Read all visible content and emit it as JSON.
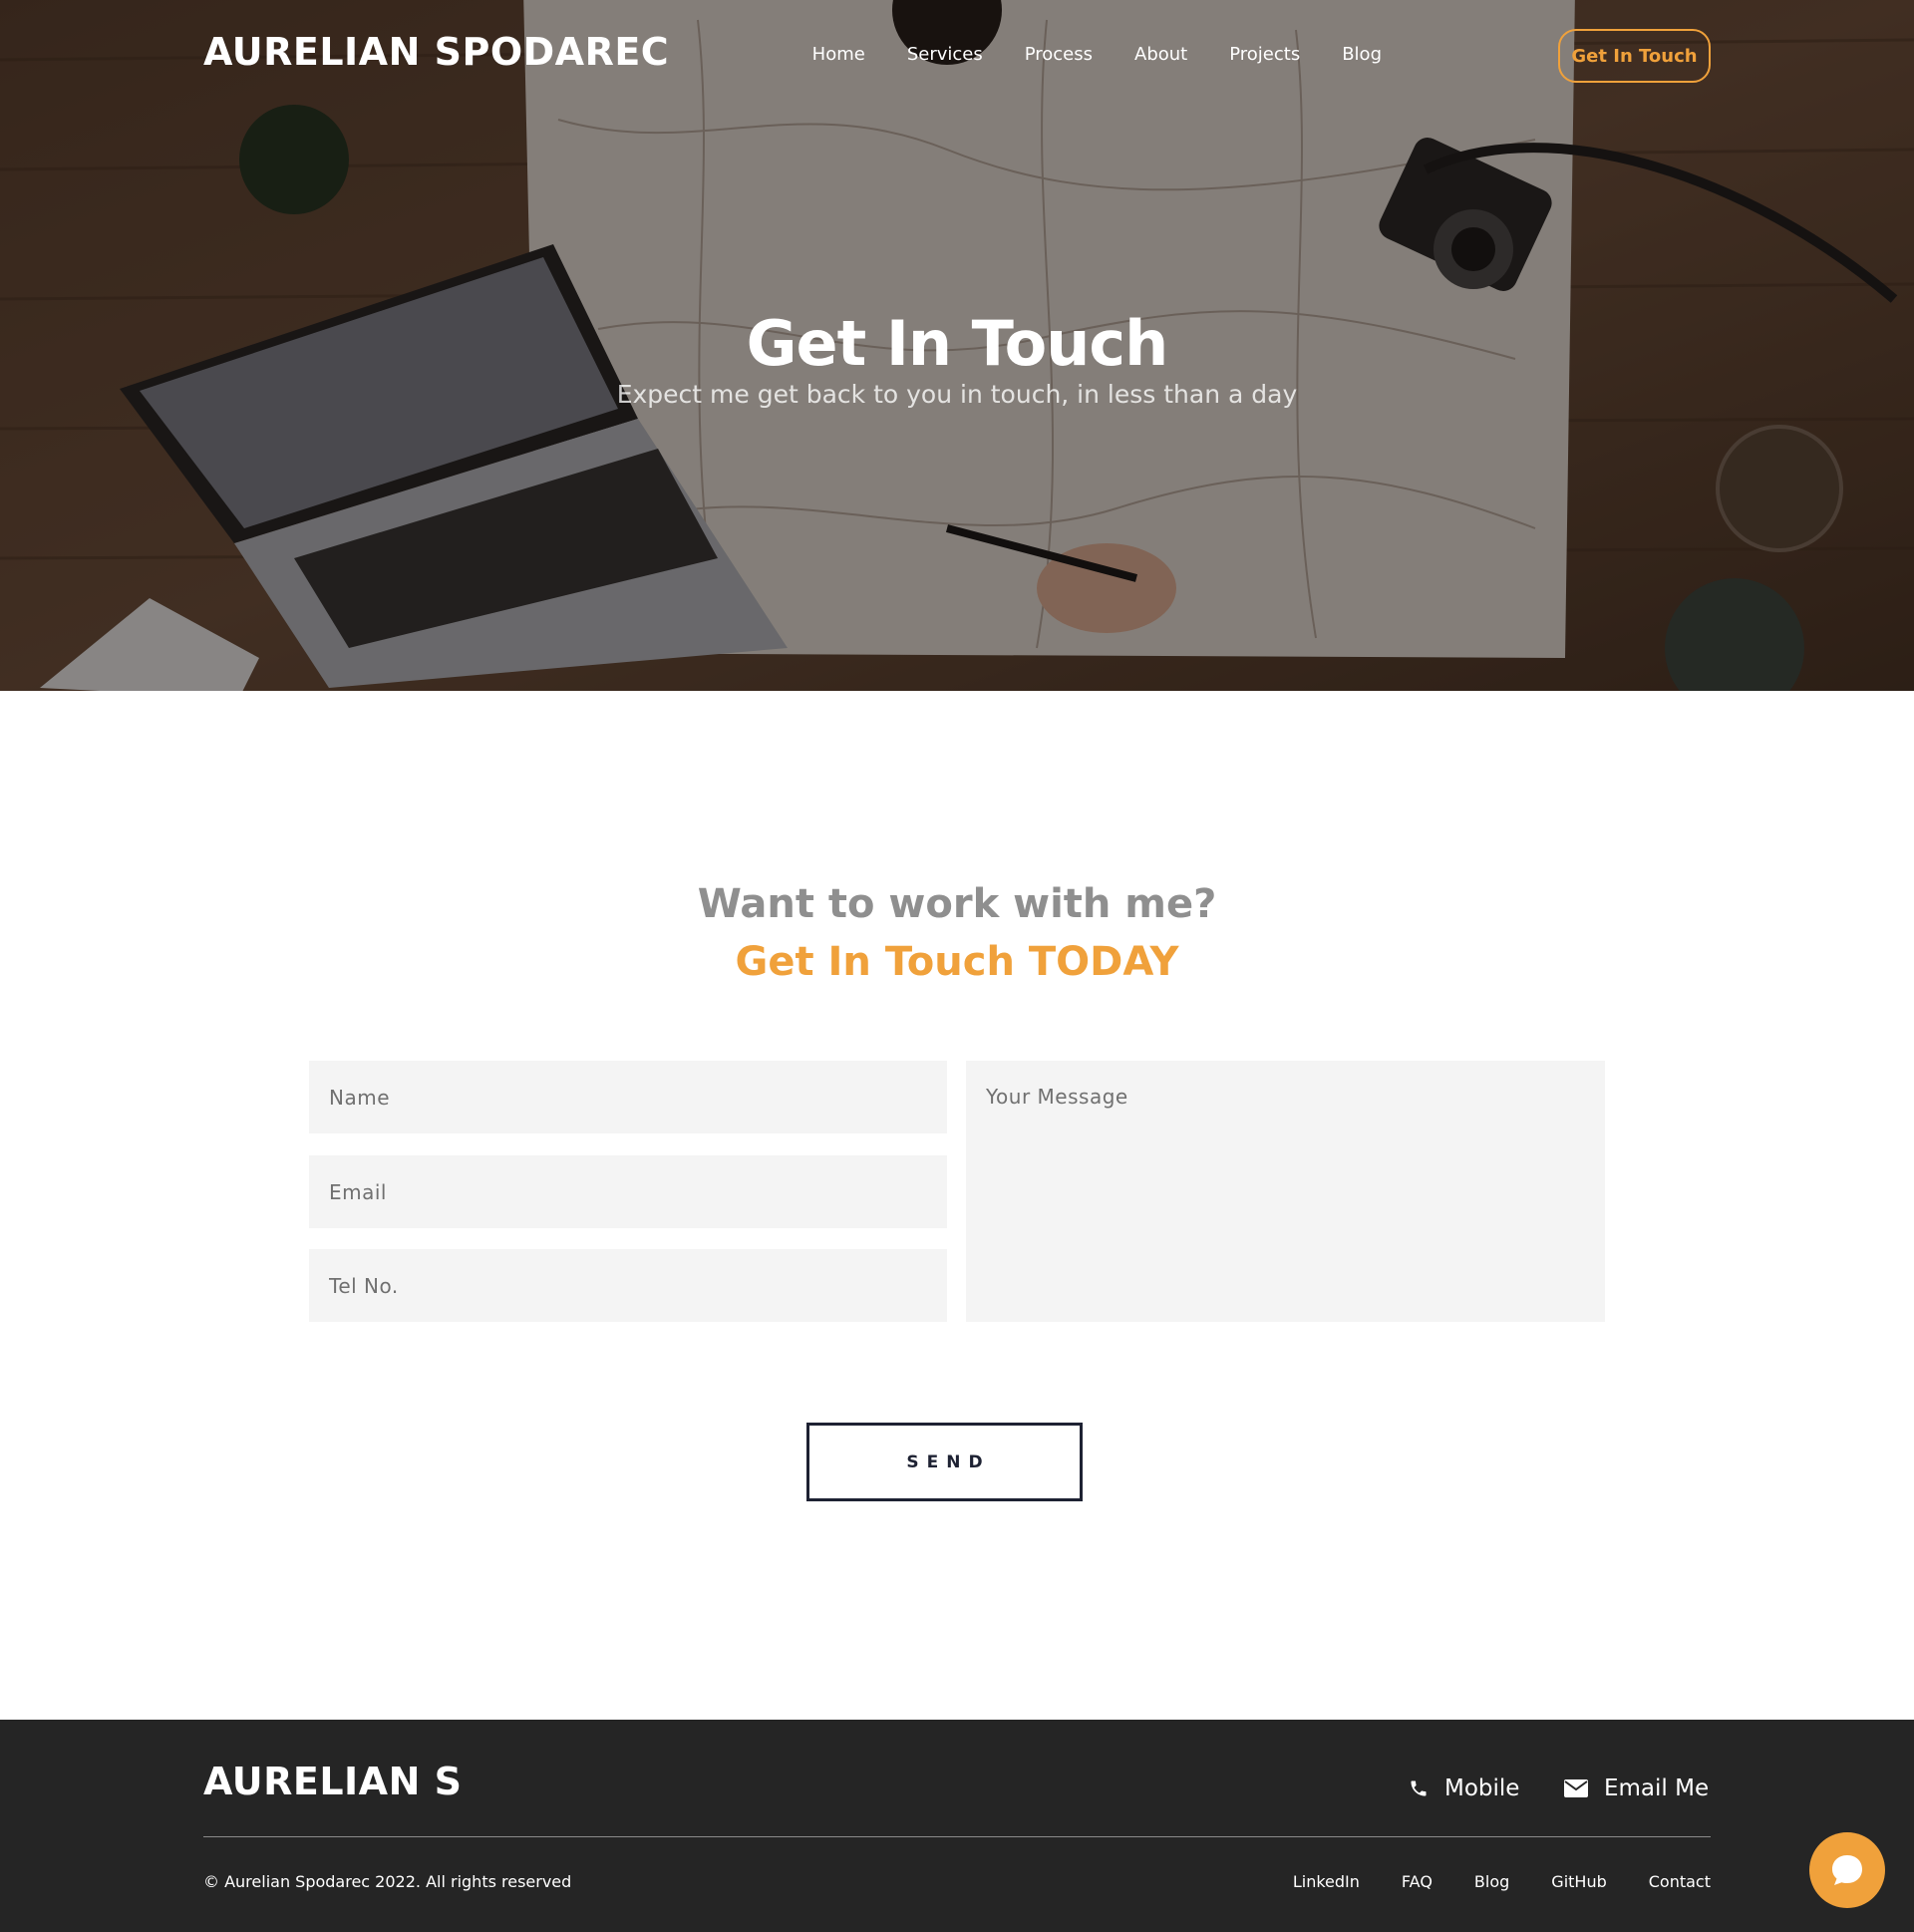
{
  "header": {
    "brand": "AURELIAN SPODAREC",
    "nav": [
      "Home",
      "Services",
      "Process",
      "About",
      "Projects",
      "Blog"
    ],
    "cta_label": "Get In Touch"
  },
  "hero": {
    "title": "Get In Touch",
    "subtitle": "Expect me get back to you in touch, in less than a day"
  },
  "contact": {
    "question": "Want to work with me?",
    "tagline": "Get In Touch TODAY",
    "fields": {
      "name_placeholder": "Name",
      "email_placeholder": "Email",
      "tel_placeholder": "Tel No.",
      "message_placeholder": "Your Message"
    },
    "send_label": "SEND"
  },
  "footer": {
    "brand": "AURELIAN S",
    "mobile_label": "Mobile",
    "email_label": "Email Me",
    "copyright": "© Aurelian Spodarec 2022. All rights reserved",
    "links": [
      "LinkedIn",
      "FAQ",
      "Blog",
      "GitHub",
      "Contact"
    ]
  },
  "icons": {
    "phone": "phone-icon",
    "envelope": "envelope-icon",
    "chat": "chat-bubble-icon"
  },
  "colors": {
    "accent": "#f0a13b",
    "footer_bg": "#252525",
    "field_bg": "#f4f4f4",
    "button_border": "#1e2233"
  }
}
